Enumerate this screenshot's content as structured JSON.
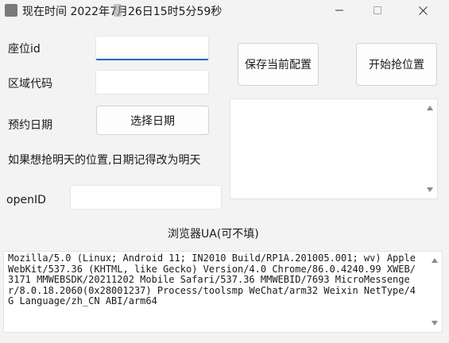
{
  "window": {
    "title": "现在时间 2022年7月26日15时5分59秒",
    "icon": "app-icon",
    "minimize_icon": "minimize-icon",
    "maximize_icon": "maximize-icon",
    "close_icon": "close-icon"
  },
  "form": {
    "seat_id_label": "座位id",
    "seat_id_value": "",
    "area_code_label": "区域代码",
    "area_code_value": "",
    "date_label": "预约日期",
    "select_date_button": "选择日期",
    "hint": "如果想抢明天的位置,日期记得改为明天",
    "openid_label": "openID",
    "openid_value": "",
    "ua_label": "浏览器UA(可不填)",
    "ua_value": "Mozilla/5.0 (Linux; Android 11; IN2010 Build/RP1A.201005.001; wv) AppleWebKit/537.36 (KHTML, like Gecko) Version/4.0 Chrome/86.0.4240.99 XWEB/3171 MMWEBSDK/20211202 Mobile Safari/537.36 MMWEBID/7693 MicroMessenger/8.0.18.2060(0x28001237) Process/toolsmp WeChat/arm32 Weixin NetType/4G Language/zh_CN ABI/arm64"
  },
  "actions": {
    "save_config": "保存当前配置",
    "start_grab": "开始抢位置"
  },
  "log": {
    "content": ""
  }
}
